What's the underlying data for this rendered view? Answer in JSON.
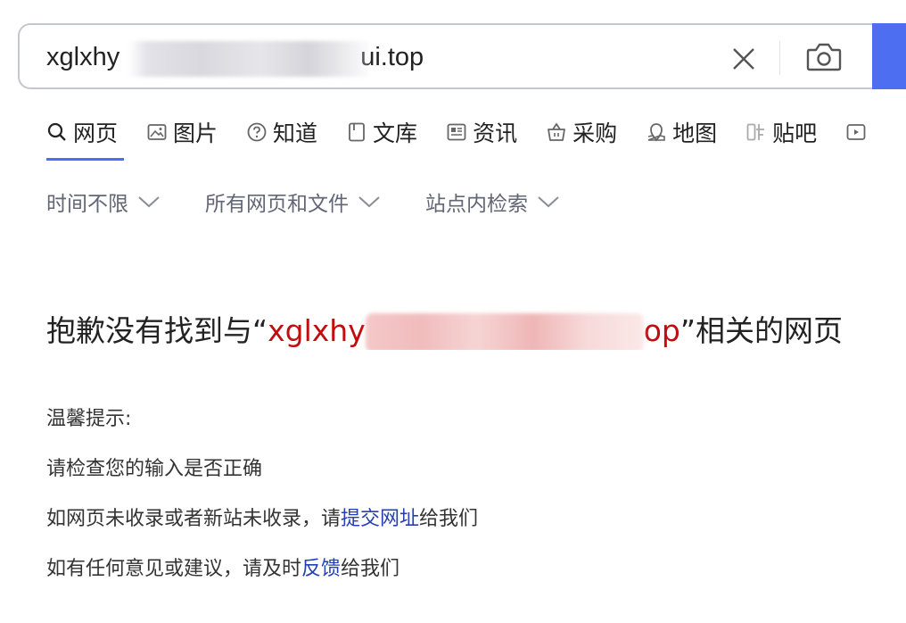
{
  "search": {
    "query_prefix": "xglxhy",
    "query_suffix": "ui.top",
    "clear_label": "×",
    "camera_icon": "camera-icon"
  },
  "tabs": [
    {
      "label": "网页",
      "icon": "search-icon",
      "active": true
    },
    {
      "label": "图片",
      "icon": "image-icon"
    },
    {
      "label": "知道",
      "icon": "question-icon"
    },
    {
      "label": "文库",
      "icon": "document-icon"
    },
    {
      "label": "资讯",
      "icon": "news-icon"
    },
    {
      "label": "采购",
      "icon": "basket-icon"
    },
    {
      "label": "地图",
      "icon": "map-pin-icon"
    },
    {
      "label": "贴吧",
      "icon": "tieba-icon"
    },
    {
      "label": "",
      "icon": "video-icon"
    }
  ],
  "filters": [
    {
      "label": "时间不限"
    },
    {
      "label": "所有网页和文件"
    },
    {
      "label": "站点内检索"
    }
  ],
  "result": {
    "headline_prefix": "抱歉没有找到与“",
    "query_start": "xglxhy",
    "query_end": "op",
    "headline_suffix": "”相关的网页"
  },
  "tips": {
    "title": "温馨提示:",
    "line1": "请检查您的输入是否正确",
    "line2_prefix": "如网页未收录或者新站未收录，请",
    "line2_link": "提交网址",
    "line2_suffix": "给我们",
    "line3_prefix": "如有任何意见或建议，请及时",
    "line3_link": "反馈",
    "line3_suffix": "给我们"
  },
  "colors": {
    "accent": "#4e6ef2",
    "query_red": "#c00e0e",
    "link": "#2440b3",
    "filter_gray": "#626675"
  }
}
